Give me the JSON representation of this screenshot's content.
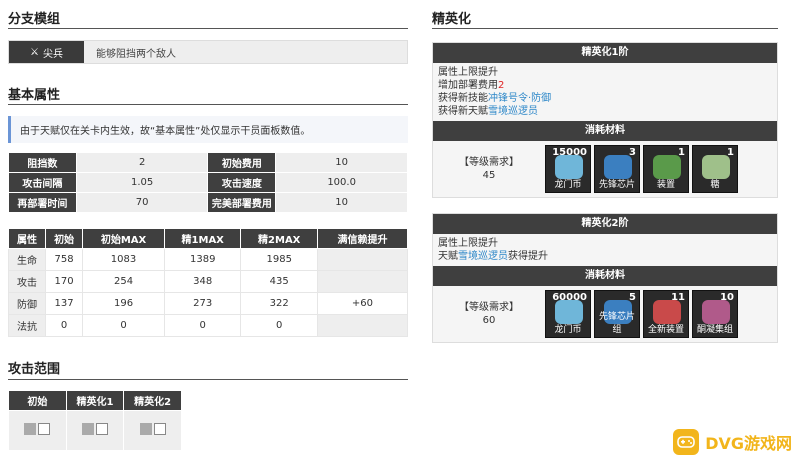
{
  "branch": {
    "title": "分支模组",
    "tag": "尖兵",
    "desc": "能够阻挡两个敌人"
  },
  "base": {
    "title": "基本属性",
    "note": "由于天赋仅在关卡内生效，故“基本属性”处仅显示干员面板数值。",
    "attrs": [
      {
        "l1": "阻挡数",
        "v1": "2",
        "l2": "初始费用",
        "v2": "10"
      },
      {
        "l1": "攻击间隔",
        "v1": "1.05",
        "l2": "攻击速度",
        "v2": "100.0"
      },
      {
        "l1": "再部署时间",
        "v1": "70",
        "l2": "完美部署费用",
        "v2": "10"
      }
    ],
    "stats_headers": [
      "属性",
      "初始",
      "初始MAX",
      "精1MAX",
      "精2MAX",
      "满信赖提升"
    ],
    "stats": [
      [
        "生命",
        "758",
        "1083",
        "1389",
        "1985",
        ""
      ],
      [
        "攻击",
        "170",
        "254",
        "348",
        "435",
        ""
      ],
      [
        "防御",
        "137",
        "196",
        "273",
        "322",
        "+60"
      ],
      [
        "法抗",
        "0",
        "0",
        "0",
        "0",
        ""
      ]
    ]
  },
  "range": {
    "title": "攻击范围",
    "headers": [
      "初始",
      "精英化1",
      "精英化2"
    ]
  },
  "elite": {
    "title": "精英化",
    "stage1": {
      "head": "精英化1阶",
      "line1": "属性上限提升",
      "line2_prefix": "增加部署费用",
      "line2_value": "2",
      "line3_prefix": "获得新技能",
      "line3_link": "冲锋号令·防御",
      "line4_prefix": "获得新天赋",
      "line4_link": "雪境巡逻员",
      "mat_head": "消耗材料",
      "req_label": "【等级需求】",
      "req_value": "45",
      "items": [
        {
          "count": "15000",
          "label": "龙门币",
          "icon": "lmd-icon",
          "color": "#6fb6d9"
        },
        {
          "count": "3",
          "label": "先锋芯片",
          "icon": "chip-icon",
          "color": "#3b7fc0"
        },
        {
          "count": "1",
          "label": "装置",
          "icon": "device-icon",
          "color": "#5a9a4a"
        },
        {
          "count": "1",
          "label": "糖",
          "icon": "sugar-icon",
          "color": "#9fc08a"
        }
      ]
    },
    "stage2": {
      "head": "精英化2阶",
      "line1": "属性上限提升",
      "line2_prefix": "天赋",
      "line2_link": "雪境巡逻员",
      "line2_suffix": "获得提升",
      "mat_head": "消耗材料",
      "req_label": "【等级需求】",
      "req_value": "60",
      "items": [
        {
          "count": "60000",
          "label": "龙门币",
          "icon": "lmd-icon",
          "color": "#6fb6d9"
        },
        {
          "count": "5",
          "label": "先锋芯片组",
          "icon": "chipset-icon",
          "color": "#3b7fc0"
        },
        {
          "count": "11",
          "label": "全新装置",
          "icon": "new-device-icon",
          "color": "#c94a4a"
        },
        {
          "count": "10",
          "label": "酮凝集组",
          "icon": "ketone-icon",
          "color": "#b05a8a"
        }
      ]
    }
  },
  "watermark": {
    "text": "DVG游戏网"
  }
}
